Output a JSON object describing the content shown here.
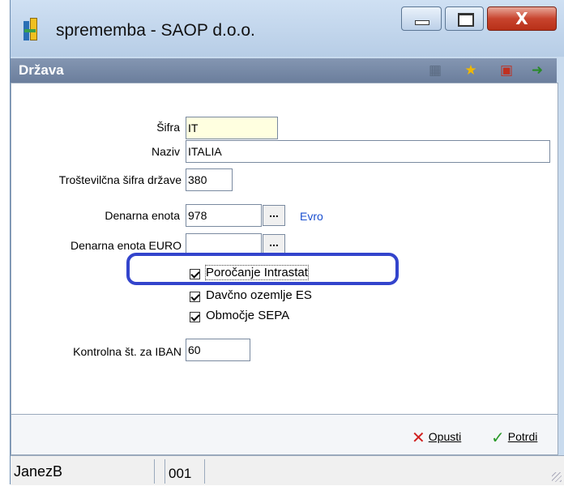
{
  "window": {
    "title": "sprememba - SAOP d.o.o.",
    "close_label": "X"
  },
  "panel": {
    "title": "Država"
  },
  "form": {
    "sifra": {
      "label": "Šifra",
      "value": "IT"
    },
    "naziv": {
      "label": "Naziv",
      "value": "ITALIA"
    },
    "trostevilcna": {
      "label": "Troštevilčna šifra države",
      "value": "380"
    },
    "denarna_enota": {
      "label": "Denarna enota",
      "value": "978",
      "button": "...",
      "link": "Evro"
    },
    "denarna_enota_euro": {
      "label": "Denarna enota EURO",
      "value": "",
      "button": "..."
    },
    "checkboxes": [
      {
        "label": "Poročanje Intrastat",
        "checked": true
      },
      {
        "label": "Davčno ozemlje ES",
        "checked": true
      },
      {
        "label": "Območje SEPA",
        "checked": true
      }
    ],
    "iban": {
      "label": "Kontrolna št. za  IBAN",
      "value": "60"
    }
  },
  "footer": {
    "cancel_label": "Opusti",
    "confirm_label": "Potrdi"
  },
  "status": {
    "user": "JanezB",
    "code": "001"
  },
  "colors": {
    "highlight": "#3344cc",
    "link": "#1a4fd0",
    "sifra_bg": "#ffffe0"
  }
}
